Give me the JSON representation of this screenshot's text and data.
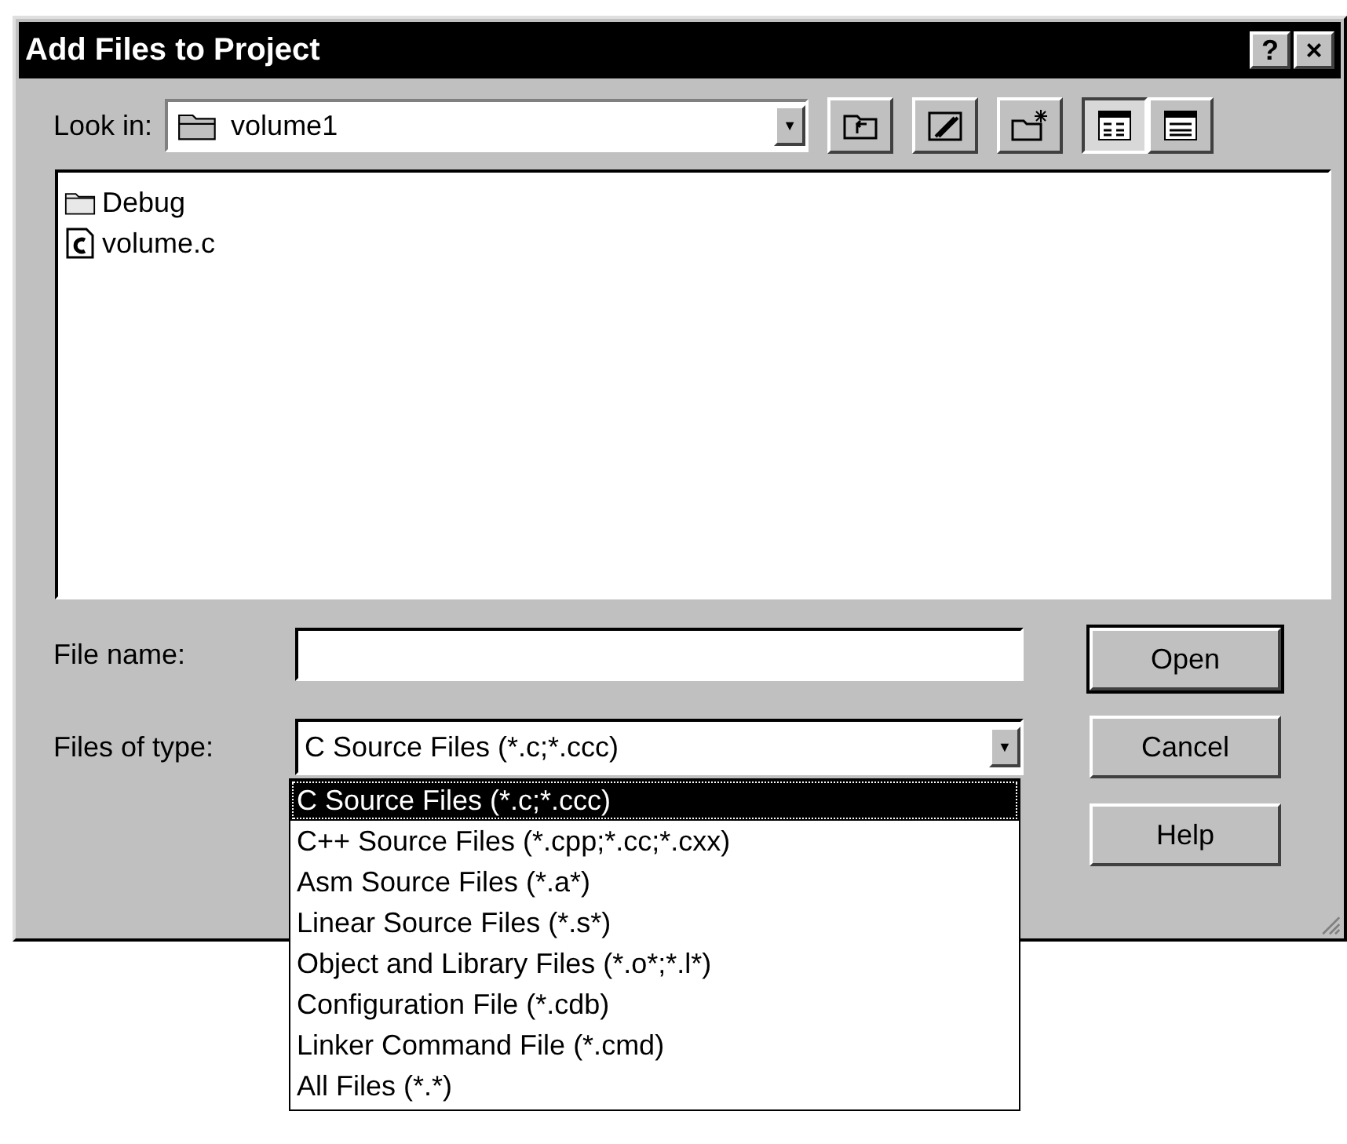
{
  "window": {
    "title": "Add Files to Project",
    "help_button": "?",
    "close_button": "×"
  },
  "look_in": {
    "label": "Look in:",
    "value": "volume1",
    "arrow": "▼"
  },
  "files": [
    {
      "kind": "folder",
      "name": "Debug",
      "selected": false
    },
    {
      "kind": "c-file",
      "name": "volume.c",
      "selected": false
    }
  ],
  "file_name": {
    "label": "File name:"
  },
  "files_of_type": {
    "label": "Files of type:",
    "value": "C Source Files (*.c;*.ccc)",
    "arrow": "▼",
    "expanded": true,
    "options": [
      {
        "label": "C Source Files (*.c;*.ccc)",
        "selected": true
      },
      {
        "label": "C++ Source Files (*.cpp;*.cc;*.cxx)",
        "selected": false
      },
      {
        "label": "Asm Source Files (*.a*)",
        "selected": false
      },
      {
        "label": "Linear Source Files (*.s*)",
        "selected": false
      },
      {
        "label": "Object and Library Files (*.o*;*.l*)",
        "selected": false
      },
      {
        "label": "Configuration File (*.cdb)",
        "selected": false
      },
      {
        "label": "Linker Command File (*.cmd)",
        "selected": false
      },
      {
        "label": "All Files (*.*)",
        "selected": false
      }
    ]
  },
  "buttons": [
    {
      "label": "Open",
      "default": true
    },
    {
      "label": "Cancel",
      "default": false
    },
    {
      "label": "Help",
      "default": false
    }
  ]
}
